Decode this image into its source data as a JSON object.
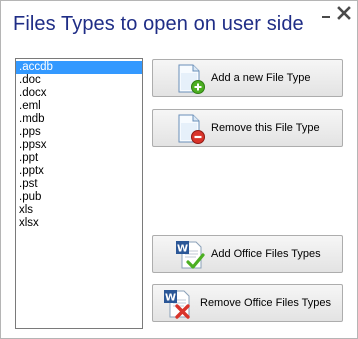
{
  "window": {
    "title": "Files Types to open on user side"
  },
  "file_types": {
    "items": [
      ".accdb",
      ".doc",
      ".docx",
      ".eml",
      ".mdb",
      ".pps",
      ".ppsx",
      ".ppt",
      ".pptx",
      ".pst",
      ".pub",
      "xls",
      "xlsx"
    ],
    "selected": ".accdb"
  },
  "buttons": {
    "add_file_type": "Add a new File Type",
    "remove_file_type": "Remove this File Type",
    "add_office": "Add Office Files Types",
    "remove_office": "Remove Office Files Types"
  },
  "icons": {
    "minimize": "minimize-icon",
    "close": "close-icon",
    "add_file": "document-add-icon",
    "remove_file": "document-remove-icon",
    "add_office": "word-check-icon",
    "remove_office": "word-remove-icon"
  },
  "colors": {
    "title": "#1f2d86",
    "selection": "#3399ff",
    "add_badge": "#4caf22",
    "remove_badge": "#d9342b",
    "word_blue": "#2b5797"
  }
}
